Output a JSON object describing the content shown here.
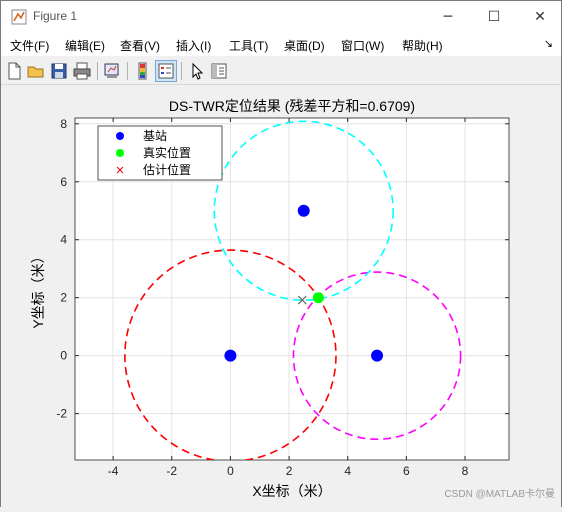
{
  "window": {
    "title": "Figure 1",
    "controls": {
      "minimize": "─",
      "maximize": "☐",
      "close": "✕"
    }
  },
  "menubar": {
    "items": [
      "文件(F)",
      "编辑(E)",
      "查看(V)",
      "插入(I)",
      "工具(T)",
      "桌面(D)",
      "窗口(W)",
      "帮助(H)"
    ],
    "overflow_arrow": "↘"
  },
  "toolbar": {
    "icons": [
      "new-figure-icon",
      "open-file-icon",
      "save-icon",
      "print-icon",
      "link-plot-icon",
      "insert-colorbar-icon",
      "insert-legend-icon",
      "edit-plot-icon",
      "property-inspector-icon"
    ]
  },
  "chart_data": {
    "type": "scatter",
    "title": "DS-TWR定位结果 (残差平方和=0.6709)",
    "xlabel": "X坐标（米）",
    "ylabel": "Y坐标（米）",
    "xlim": [
      -5.3,
      9.5
    ],
    "ylim": [
      -3.6,
      8.2
    ],
    "xticks": [
      -4,
      -2,
      0,
      2,
      4,
      6,
      8
    ],
    "yticks": [
      -2,
      0,
      2,
      4,
      6,
      8
    ],
    "grid": true,
    "legend_position": "top-left",
    "series": [
      {
        "name": "基站",
        "marker": "filled-circle",
        "color": "#0000ff",
        "points": [
          [
            0,
            0
          ],
          [
            5,
            0
          ],
          [
            2.5,
            5
          ]
        ]
      },
      {
        "name": "真实位置",
        "marker": "filled-circle",
        "color": "#00ff00",
        "points": [
          [
            3,
            2
          ]
        ]
      },
      {
        "name": "估计位置",
        "marker": "x",
        "color": "#ff0000",
        "points": [
          [
            2.45,
            1.92
          ]
        ]
      }
    ],
    "range_circles": [
      {
        "center": [
          0,
          0
        ],
        "radius": 3.6,
        "color": "#ff0000"
      },
      {
        "center": [
          5,
          0
        ],
        "radius": 2.85,
        "color": "#ff00ff"
      },
      {
        "center": [
          2.5,
          5
        ],
        "radius": 3.05,
        "color": "#00ffff"
      }
    ]
  },
  "watermark": "CSDN @MATLAB卡尔曼"
}
